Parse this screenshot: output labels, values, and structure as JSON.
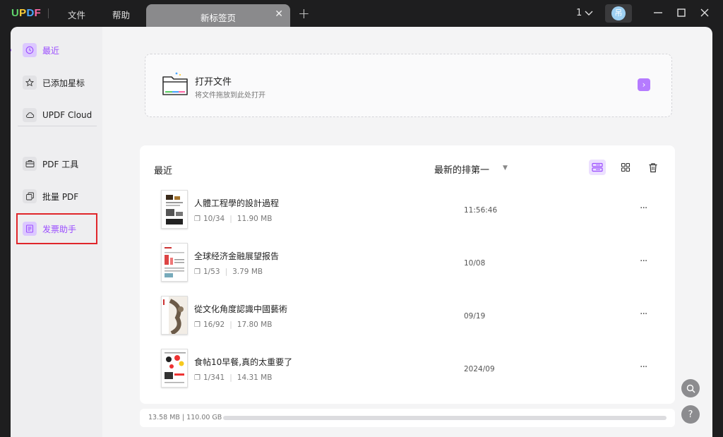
{
  "titlebar": {
    "logo": {
      "u": "U",
      "p": "P",
      "d": "D",
      "f": "F"
    },
    "menu_file": "文件",
    "menu_help": "帮助",
    "tab_title": "新标签页",
    "tab_close": "✕",
    "new_tab": "+",
    "window_count": "1",
    "user_initial": "吊"
  },
  "sidebar": {
    "items": [
      {
        "label": "最近",
        "icon": "clock-icon",
        "active": true
      },
      {
        "label": "已添加星标",
        "icon": "star-icon"
      },
      {
        "label": "UPDF Cloud",
        "icon": "cloud-icon"
      },
      {
        "label": "PDF 工具",
        "icon": "toolbox-icon"
      },
      {
        "label": "批量 PDF",
        "icon": "batch-icon"
      },
      {
        "label": "发票助手",
        "icon": "invoice-icon",
        "highlighted": true
      }
    ]
  },
  "open_card": {
    "title": "打开文件",
    "subtitle": "将文件拖放到此处打开",
    "arrow": "›"
  },
  "recent": {
    "title": "最近",
    "sort_label": "最新的排第一",
    "files": [
      {
        "name": "人體工程學的設計過程",
        "pages": "10/34",
        "size": "11.90 MB",
        "time": "11:56:46"
      },
      {
        "name": "全球经济金融展望报告",
        "pages": "1/53",
        "size": "3.79 MB",
        "time": "10/08"
      },
      {
        "name": "從文化角度認識中國藝術",
        "pages": "16/92",
        "size": "17.80 MB",
        "time": "09/19"
      },
      {
        "name": "食帖10早餐,真的太重要了",
        "pages": "1/341",
        "size": "14.31 MB",
        "time": "2024/09"
      }
    ],
    "more": "···"
  },
  "storage": {
    "text": "13.58 MB | 110.00 GB",
    "used_fraction": 0.0001
  },
  "colors": {
    "accent": "#9b4dff",
    "highlight_border": "#e0262b"
  }
}
